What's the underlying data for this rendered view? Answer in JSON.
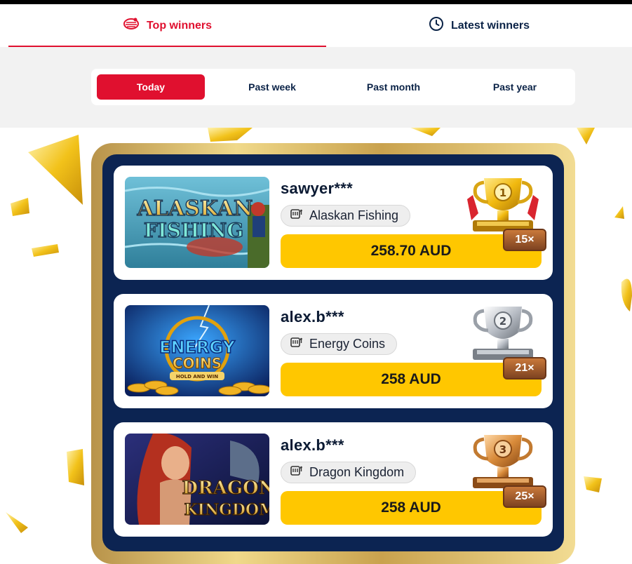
{
  "tabs": [
    {
      "label": "Top winners",
      "icon": "flame-stack-icon",
      "active": true
    },
    {
      "label": "Latest winners",
      "icon": "clock-icon",
      "active": false
    }
  ],
  "periods": [
    {
      "label": "Today",
      "active": true
    },
    {
      "label": "Past week",
      "active": false
    },
    {
      "label": "Past month",
      "active": false
    },
    {
      "label": "Past year",
      "active": false
    }
  ],
  "winners": [
    {
      "rank": "1",
      "username": "sawyer***",
      "game": "Alaskan Fishing",
      "amount": "258.70 AUD",
      "multiplier": "15×",
      "trophy": "gold-trophy-icon",
      "thumb_line1": "ALASKAN",
      "thumb_line2": "FISHING"
    },
    {
      "rank": "2",
      "username": "alex.b***",
      "game": "Energy Coins",
      "amount": "258 AUD",
      "multiplier": "21×",
      "trophy": "silver-trophy-icon",
      "thumb_line1": "ENERGY",
      "thumb_line2": "COINS",
      "thumb_line3": "HOLD AND WIN"
    },
    {
      "rank": "3",
      "username": "alex.b***",
      "game": "Dragon Kingdom",
      "amount": "258 AUD",
      "multiplier": "25×",
      "trophy": "bronze-trophy-icon",
      "thumb_line1": "DRAGON",
      "thumb_line2": "KINGDOM"
    }
  ],
  "colors": {
    "accent": "#e0102f",
    "navy": "#0c2452",
    "gold": "#ffc700"
  }
}
